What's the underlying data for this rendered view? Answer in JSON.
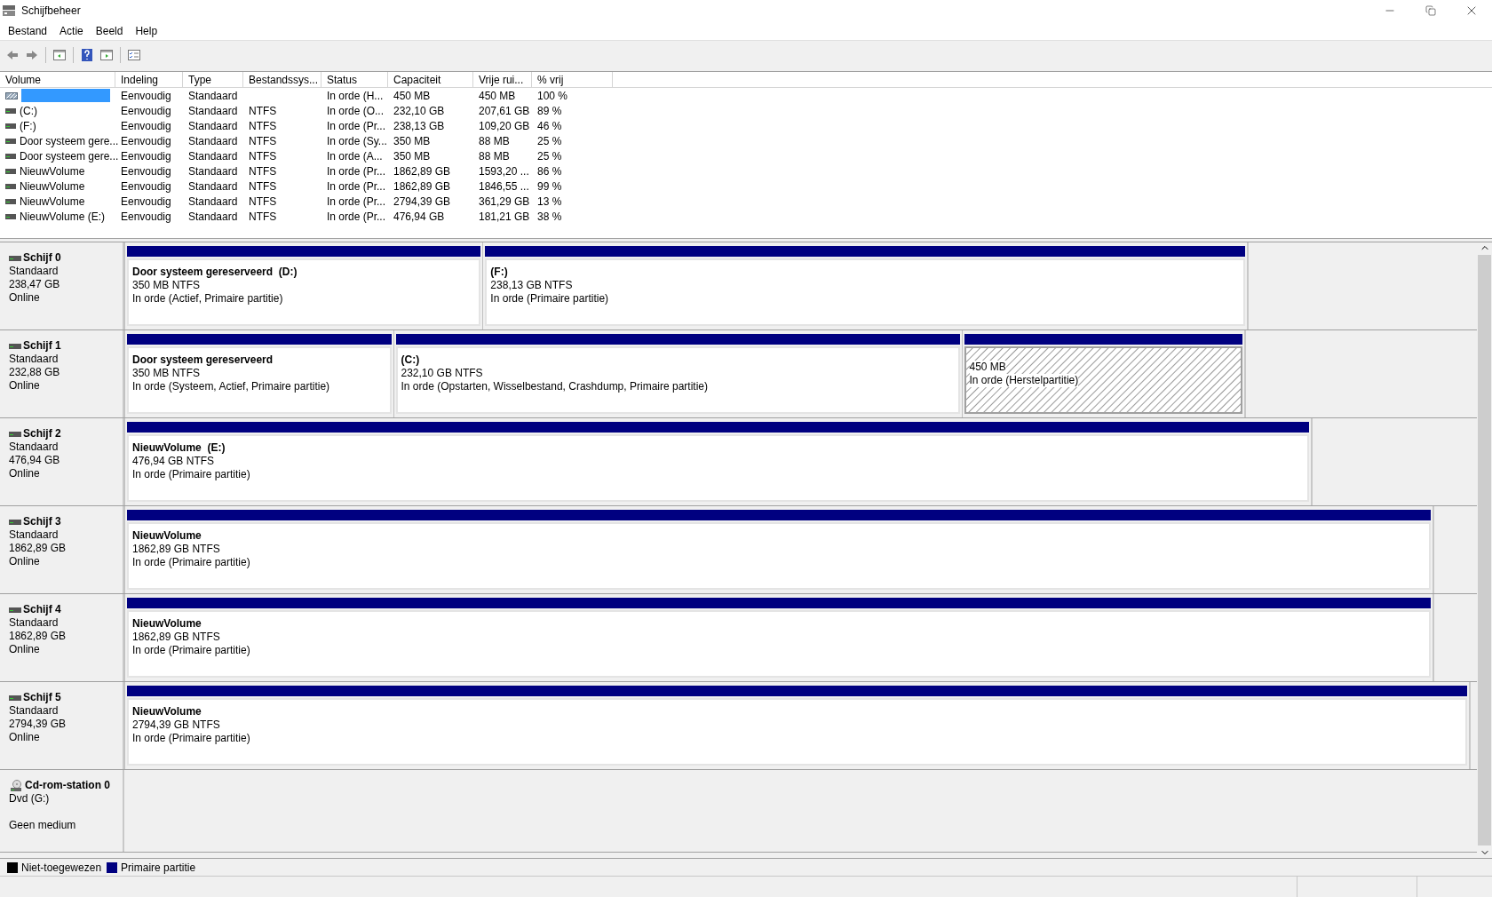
{
  "window": {
    "title": "Schijfbeheer"
  },
  "menu": [
    "Bestand",
    "Actie",
    "Beeld",
    "Help"
  ],
  "table": {
    "columns": [
      "Volume",
      "Indeling",
      "Type",
      "Bestandssys...",
      "Status",
      "Capaciteit",
      "Vrije rui...",
      "% vrij"
    ],
    "rows": [
      {
        "kind": "recovery",
        "selected": true,
        "cells": [
          null,
          "Eenvoudig",
          "Standaard",
          null,
          "In orde (H...",
          "450 MB",
          "450 MB",
          "100 %"
        ]
      },
      {
        "kind": "drive",
        "selected": false,
        "cells": [
          "(C:)",
          "Eenvoudig",
          "Standaard",
          "NTFS",
          "In orde (O...",
          "232,10 GB",
          "207,61 GB",
          "89 %"
        ]
      },
      {
        "kind": "drive",
        "selected": false,
        "cells": [
          "(F:)",
          "Eenvoudig",
          "Standaard",
          "NTFS",
          "In orde (Pr...",
          "238,13 GB",
          "109,20 GB",
          "46 %"
        ]
      },
      {
        "kind": "drive",
        "selected": false,
        "cells": [
          "Door systeem gere...",
          "Eenvoudig",
          "Standaard",
          "NTFS",
          "In orde (Sy...",
          "350 MB",
          "88 MB",
          "25 %"
        ]
      },
      {
        "kind": "drive",
        "selected": false,
        "cells": [
          "Door systeem gere...",
          "Eenvoudig",
          "Standaard",
          "NTFS",
          "In orde (A...",
          "350 MB",
          "88 MB",
          "25 %"
        ]
      },
      {
        "kind": "drive",
        "selected": false,
        "cells": [
          "NieuwVolume",
          "Eenvoudig",
          "Standaard",
          "NTFS",
          "In orde (Pr...",
          "1862,89 GB",
          "1593,20 ...",
          "86 %"
        ]
      },
      {
        "kind": "drive",
        "selected": false,
        "cells": [
          "NieuwVolume",
          "Eenvoudig",
          "Standaard",
          "NTFS",
          "In orde (Pr...",
          "1862,89 GB",
          "1846,55 ...",
          "99 %"
        ]
      },
      {
        "kind": "drive",
        "selected": false,
        "cells": [
          "NieuwVolume",
          "Eenvoudig",
          "Standaard",
          "NTFS",
          "In orde (Pr...",
          "2794,39 GB",
          "361,29 GB",
          "13 %"
        ]
      },
      {
        "kind": "drive",
        "selected": false,
        "cells": [
          "NieuwVolume (E:)",
          "Eenvoudig",
          "Standaard",
          "NTFS",
          "In orde (Pr...",
          "476,94 GB",
          "181,21 GB",
          "38 %"
        ]
      }
    ]
  },
  "disks": [
    {
      "kind": "disk",
      "name": "Schijf 0",
      "lines": [
        "Standaard",
        "238,47 GB",
        "Online"
      ],
      "partitions": [
        {
          "title": "Door systeem gereserveerd  (D:)",
          "size": "350 MB NTFS",
          "status": "In orde (Actief, Primaire partitie)",
          "selected": false
        },
        {
          "title": "(F:)",
          "size": "238,13 GB NTFS",
          "status": "In orde (Primaire partitie)",
          "selected": false
        }
      ]
    },
    {
      "kind": "disk",
      "name": "Schijf 1",
      "lines": [
        "Standaard",
        "232,88 GB",
        "Online"
      ],
      "partitions": [
        {
          "title": "Door systeem gereserveerd",
          "size": "350 MB NTFS",
          "status": "In orde (Systeem, Actief, Primaire partitie)",
          "selected": false
        },
        {
          "title": "(C:)",
          "size": "232,10 GB NTFS",
          "status": "In orde (Opstarten, Wisselbestand, Crashdump, Primaire partitie)",
          "selected": false
        },
        {
          "size": "450 MB",
          "status": "In orde (Herstelpartitie)",
          "selected": true
        }
      ]
    },
    {
      "kind": "disk",
      "name": "Schijf 2",
      "lines": [
        "Standaard",
        "476,94 GB",
        "Online"
      ],
      "partitions": [
        {
          "title": "NieuwVolume  (E:)",
          "size": "476,94 GB NTFS",
          "status": "In orde (Primaire partitie)",
          "selected": false
        }
      ]
    },
    {
      "kind": "disk",
      "name": "Schijf 3",
      "lines": [
        "Standaard",
        "1862,89 GB",
        "Online"
      ],
      "partitions": [
        {
          "title": "NieuwVolume",
          "size": "1862,89 GB NTFS",
          "status": "In orde (Primaire partitie)",
          "selected": false
        }
      ]
    },
    {
      "kind": "disk",
      "name": "Schijf 4",
      "lines": [
        "Standaard",
        "1862,89 GB",
        "Online"
      ],
      "partitions": [
        {
          "title": "NieuwVolume",
          "size": "1862,89 GB NTFS",
          "status": "In orde (Primaire partitie)",
          "selected": false
        }
      ]
    },
    {
      "kind": "disk",
      "name": "Schijf 5",
      "lines": [
        "Standaard",
        "2794,39 GB",
        "Online"
      ],
      "partitions": [
        {
          "title": "NieuwVolume",
          "size": "2794,39 GB NTFS",
          "status": "In orde (Primaire partitie)",
          "selected": false
        }
      ]
    },
    {
      "kind": "cdrom",
      "name": "Cd-rom-station 0",
      "lines": [
        "Dvd (G:)"
      ],
      "media": "Geen medium"
    }
  ],
  "legend": [
    {
      "label": "Niet-toegewezen",
      "color": "#000000"
    },
    {
      "label": "Primaire partitie",
      "color": "#000080"
    }
  ]
}
